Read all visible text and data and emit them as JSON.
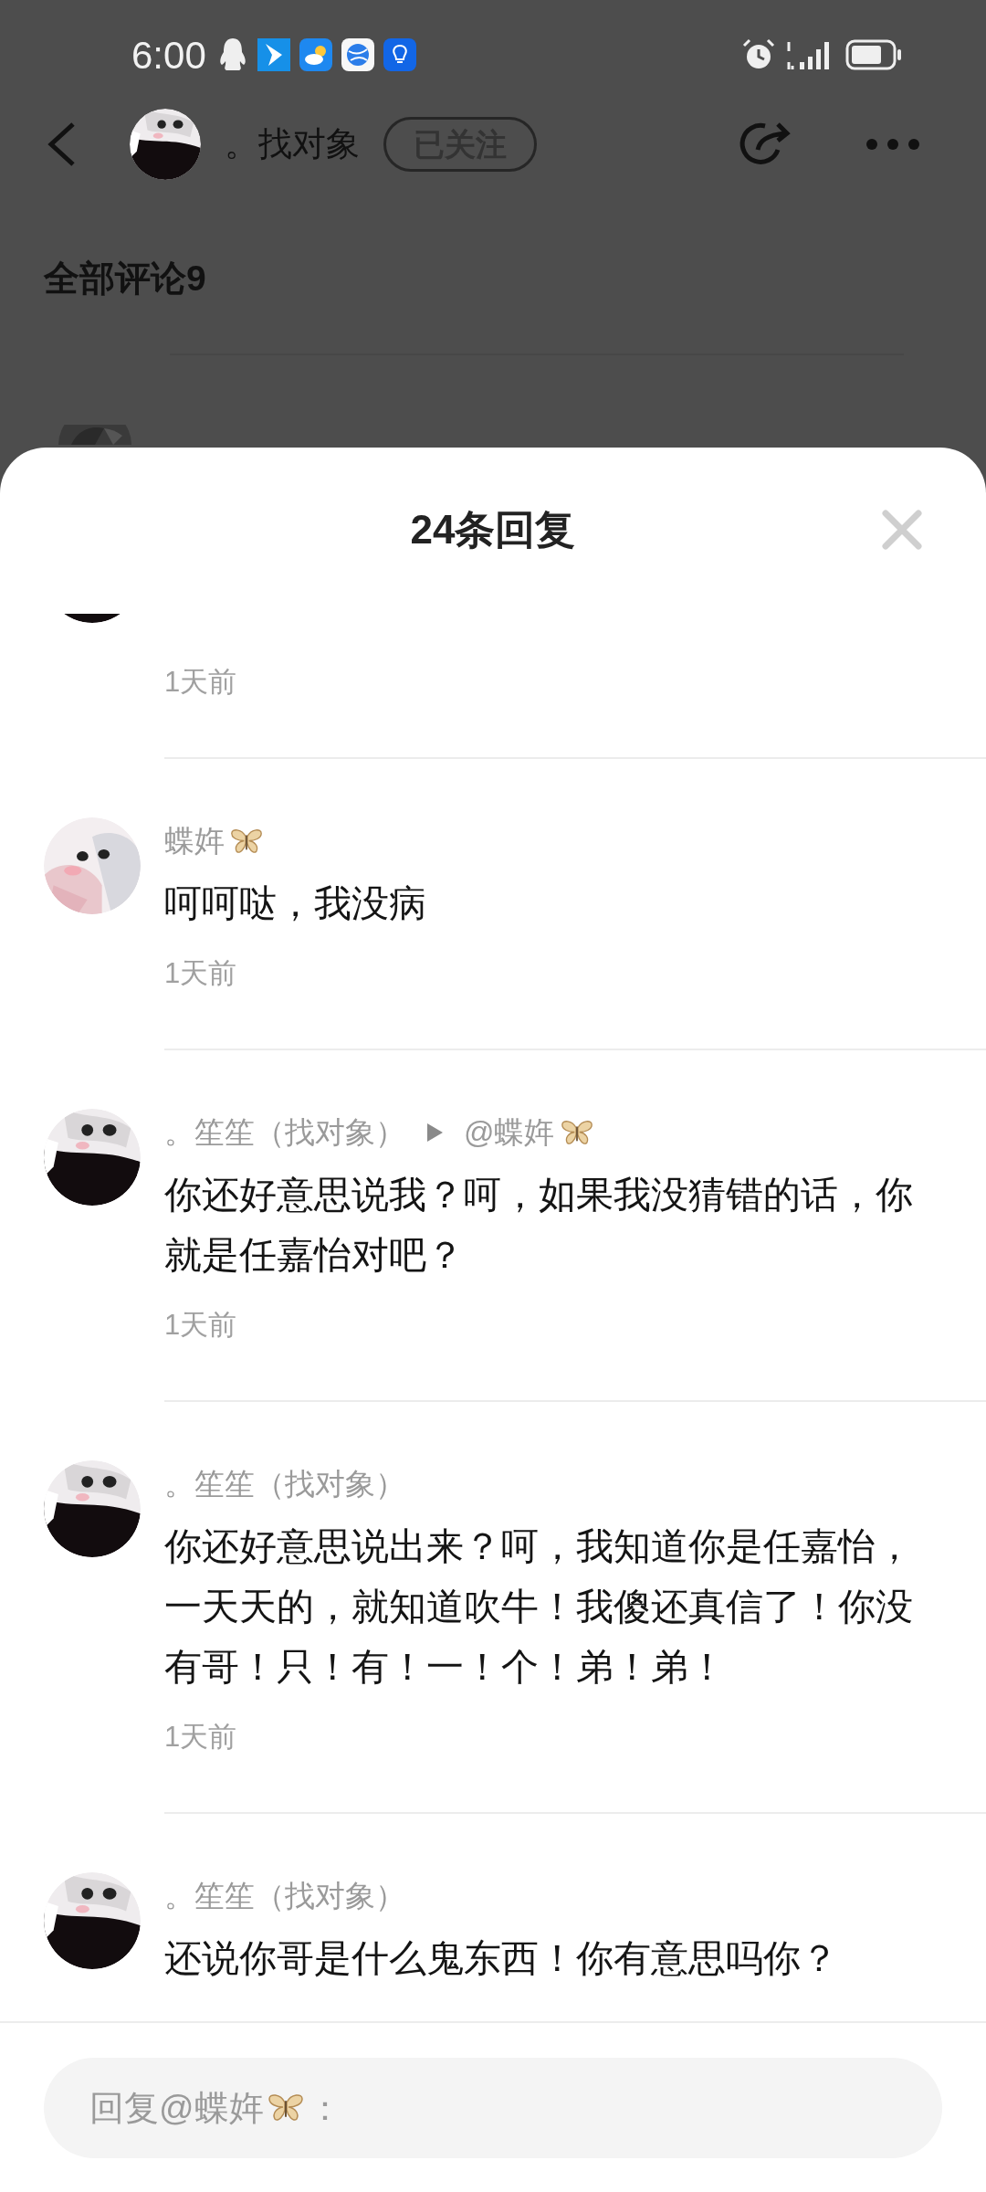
{
  "status_bar": {
    "time": "6:00"
  },
  "header": {
    "author": "。找对象",
    "follow": {
      "label": "已关注",
      "following": true
    }
  },
  "section_title": "全部评论9",
  "sheet": {
    "title": "24条回复",
    "comments": [
      {
        "time": "1天前"
      },
      {
        "author": {
          "text": "蝶姩",
          "butterfly": true
        },
        "content": "呵呵哒，我没病",
        "time": "1天前"
      },
      {
        "author": {
          "text": "。笙笙（找对象）",
          "butterfly": false
        },
        "reply_to": {
          "text": "@蝶姩",
          "butterfly": true
        },
        "content": "你还好意思说我？呵，如果我没猜错的话，你就是任嘉怡对吧？",
        "time": "1天前"
      },
      {
        "author": {
          "text": "。笙笙（找对象）",
          "butterfly": false
        },
        "content": "你还好意思说出来？呵，我知道你是任嘉怡，一天天的，就知道吹牛！我傻还真信了！你没有哥！只！有！一！个！弟！弟！",
        "time": "1天前"
      },
      {
        "author": {
          "text": "。笙笙（找对象）",
          "butterfly": false
        },
        "content": "还说你哥是什么鬼东西！你有意思吗你？"
      }
    ],
    "reply_input": {
      "placeholder": "回复@蝶姩",
      "butterfly": true,
      "placeholder_suffix": "："
    }
  }
}
